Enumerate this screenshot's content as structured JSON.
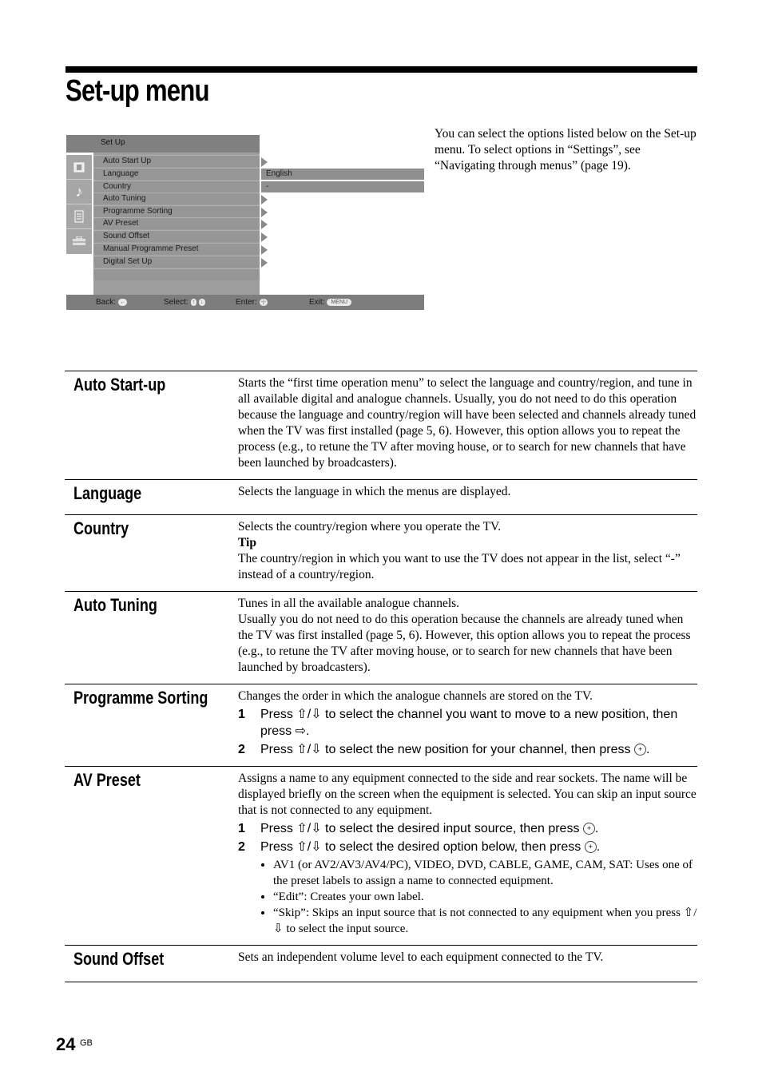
{
  "page": {
    "title": "Set-up menu",
    "intro": "You can select the options listed below on the Set-up menu. To select options in “Settings”, see “Navigating through menus” (page 19).",
    "page_number": "24",
    "page_suffix": "GB"
  },
  "tv_menu": {
    "header": "Set Up",
    "sidebar_icons": [
      "picture-icon",
      "sound-icon",
      "features-icon",
      "setup-icon"
    ],
    "items": [
      {
        "label": "Auto Start Up",
        "has_submenu": true
      },
      {
        "label": "Language",
        "value": "English"
      },
      {
        "label": "Country",
        "value": "-"
      },
      {
        "label": "Auto Tuning",
        "has_submenu": true
      },
      {
        "label": "Programme Sorting",
        "has_submenu": true
      },
      {
        "label": "AV Preset",
        "has_submenu": true
      },
      {
        "label": "Sound Offset",
        "has_submenu": true
      },
      {
        "label": "Manual Programme Preset",
        "has_submenu": true
      },
      {
        "label": "Digital Set Up",
        "has_submenu": true
      }
    ],
    "footer": {
      "back_label": "Back:",
      "back_key": "←",
      "select_label": "Select:",
      "select_keys": [
        "↑",
        "↓"
      ],
      "enter_label": "Enter:",
      "enter_key": "-|-",
      "exit_label": "Exit:",
      "exit_key": "MENU"
    }
  },
  "definitions": [
    {
      "term": "Auto Start-up",
      "text": "Starts the “first time operation menu” to select the language and country/region, and tune in all available digital and analogue channels. Usually, you do not need to do this operation because the language and country/region will have been selected and channels already tuned when the TV was first installed (page 5, 6). However, this option allows you to repeat the process (e.g., to retune the TV after moving house, or to search for new channels that have been launched by broadcasters)."
    },
    {
      "term": "Language",
      "text": "Selects the language in which the menus are displayed."
    },
    {
      "term": "Country",
      "text": "Selects the country/region where you operate the TV.",
      "tip_label": "Tip",
      "tip_text": "The country/region in which you want to use the TV does not appear in the list, select “-” instead of a country/region."
    },
    {
      "term": "Auto Tuning",
      "text": "Tunes in all the available analogue channels.",
      "text2": "Usually you do not need to do this operation because the channels are already tuned when the TV was first installed (page 5, 6). However, this option allows you to repeat the process (e.g., to retune the TV after moving house, or to search for new channels that have been launched by broadcasters)."
    },
    {
      "term": "Programme Sorting",
      "text": "Changes the order in which the analogue channels are stored on the TV.",
      "steps": [
        {
          "num": "1",
          "pre": "Press ⇧/⇩ to select the channel you want to move to a new position, then press ⇨."
        },
        {
          "num": "2",
          "pre": "Press ⇧/⇩ to select the new position for your channel, then press",
          "enter": "⊕",
          "post": "."
        }
      ]
    },
    {
      "term": "AV Preset",
      "text": "Assigns a name to any equipment connected to the side and rear sockets. The name will be displayed briefly on the screen when the equipment is selected. You can skip an input source that is not connected to any equipment.",
      "steps": [
        {
          "num": "1",
          "pre": "Press ⇧/⇩ to select the desired input source, then press",
          "enter": "⊕",
          "post": "."
        },
        {
          "num": "2",
          "pre": "Press ⇧/⇩ to select the desired option below, then press",
          "enter": "⊕",
          "post": "."
        }
      ],
      "options": [
        "AV1 (or AV2/AV3/AV4/PC), VIDEO, DVD, CABLE, GAME, CAM, SAT: Uses one of the preset labels to assign a name to connected equipment.",
        "“Edit”: Creates your own label.",
        "“Skip”: Skips an input source that is not connected to any equipment when you press ⇧/⇩ to select the input source."
      ]
    },
    {
      "term": "Sound Offset",
      "text": "Sets an independent volume level to each equipment connected to the TV."
    }
  ]
}
